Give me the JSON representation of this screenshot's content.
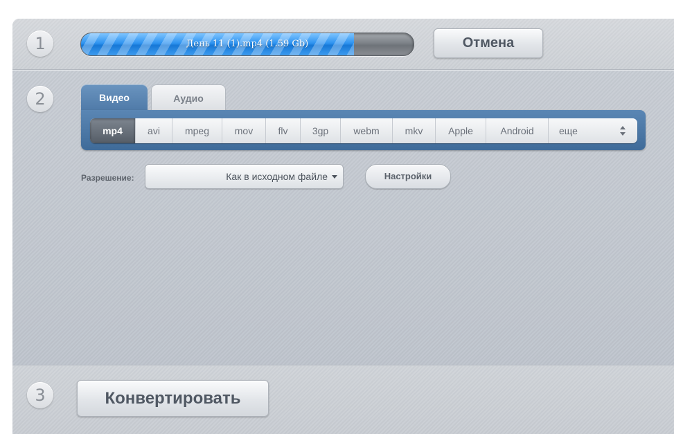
{
  "steps": {
    "one": "1",
    "two": "2",
    "three": "3"
  },
  "progress": {
    "text": "День 11 (1).mp4 (1.59 Gb)",
    "fraction": 0.82
  },
  "cancel_label": "Отмена",
  "tabs": [
    {
      "label": "Видео",
      "active": true
    },
    {
      "label": "Аудио",
      "active": false
    }
  ],
  "formats": [
    {
      "label": "mp4",
      "active": true
    },
    {
      "label": "avi"
    },
    {
      "label": "mpeg"
    },
    {
      "label": "mov"
    },
    {
      "label": "flv"
    },
    {
      "label": "3gp"
    },
    {
      "label": "webm"
    },
    {
      "label": "mkv"
    },
    {
      "label": "Apple"
    },
    {
      "label": "Android"
    },
    {
      "label": "еще"
    }
  ],
  "resolution": {
    "label": "Разрешение:",
    "value": "Как в исходном файле"
  },
  "settings_label": "Настройки",
  "convert_label": "Конвертировать",
  "icons": {
    "more": "up-down-arrows-icon",
    "select": "caret-down-icon"
  },
  "colors": {
    "progress_fill": "#2e93f0",
    "tab_active": "#4f7aa8",
    "format_active": "#5f6771"
  }
}
